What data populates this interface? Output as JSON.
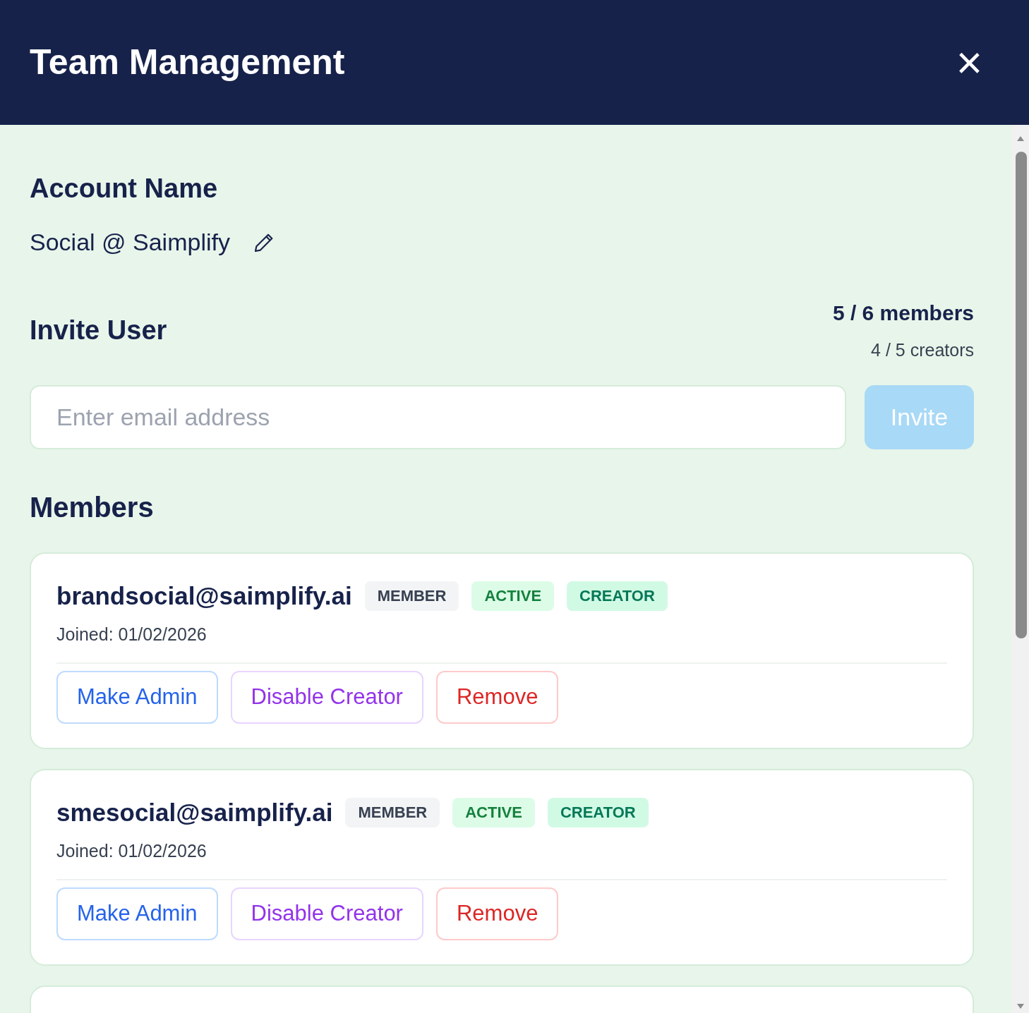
{
  "header": {
    "title": "Team Management",
    "close": "×"
  },
  "account": {
    "heading": "Account Name",
    "name": "Social @ Saimplify"
  },
  "invite": {
    "heading": "Invite User",
    "members_count": "5 / 6 members",
    "creators_count": "4 / 5 creators",
    "placeholder": "Enter email address",
    "button": "Invite",
    "disabled": true
  },
  "members": {
    "heading": "Members",
    "items": [
      {
        "email": "brandsocial@saimplify.ai",
        "badges": [
          {
            "kind": "role",
            "label": "MEMBER"
          },
          {
            "kind": "status",
            "label": "ACTIVE"
          },
          {
            "kind": "creator",
            "label": "CREATOR"
          }
        ],
        "joined": "Joined: 01/02/2026",
        "actions": [
          {
            "kind": "admin",
            "label": "Make Admin"
          },
          {
            "kind": "creator",
            "label": "Disable Creator"
          },
          {
            "kind": "remove",
            "label": "Remove"
          }
        ]
      },
      {
        "email": "smesocial@saimplify.ai",
        "badges": [
          {
            "kind": "role",
            "label": "MEMBER"
          },
          {
            "kind": "status",
            "label": "ACTIVE"
          },
          {
            "kind": "creator",
            "label": "CREATOR"
          }
        ],
        "joined": "Joined: 01/02/2026",
        "actions": [
          {
            "kind": "admin",
            "label": "Make Admin"
          },
          {
            "kind": "creator",
            "label": "Disable Creator"
          },
          {
            "kind": "remove",
            "label": "Remove"
          }
        ]
      }
    ]
  }
}
